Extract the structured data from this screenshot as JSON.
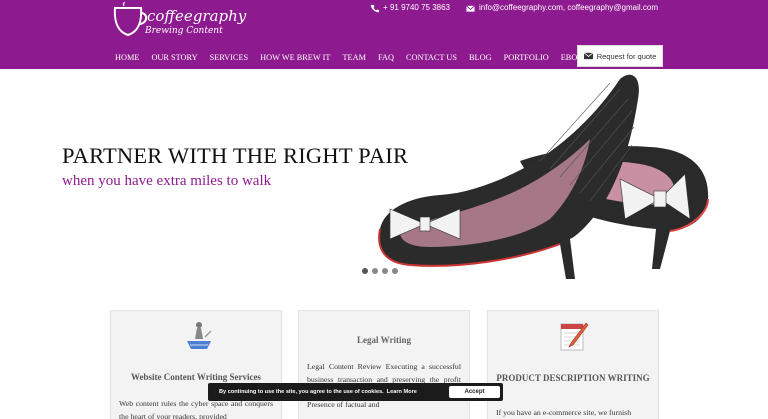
{
  "brand": {
    "name": "coffeegraphy",
    "tagline": "Brewing Content"
  },
  "contact": {
    "phone_icon": "phone-icon",
    "phone": "+ 91 9740 75 3863",
    "mail_icon": "envelope-icon",
    "email": "info@coffeegraphy.com, coffeegraphy@gmail.com"
  },
  "nav": {
    "items": [
      {
        "label": "HOME"
      },
      {
        "label": "OUR STORY"
      },
      {
        "label": "SERVICES"
      },
      {
        "label": "HOW WE BREW IT"
      },
      {
        "label": "TEAM"
      },
      {
        "label": "FAQ"
      },
      {
        "label": "CONTACT US"
      },
      {
        "label": "BLOG"
      },
      {
        "label": "PORTFOLIO"
      },
      {
        "label": "EBOOKS"
      }
    ],
    "quote_label": "Request for quote",
    "quote_icon": "envelope-icon"
  },
  "hero": {
    "title": "PARTNER WITH THE RIGHT PAIR",
    "subtitle": "when you have extra miles to walk",
    "slide_count": 4,
    "active_slide": 1
  },
  "cards": [
    {
      "icon": "writer-at-desk-icon",
      "title": "Website Content Writing Services",
      "body": "Web content rules the cyber space and conquers the heart of your readers, provided"
    },
    {
      "icon": "",
      "title": "Legal Writing",
      "body": "Legal Content Review Executing a successful business transaction and preserving the profit unwanted surprises or unavoidable litigations. Presence of factual and"
    },
    {
      "icon": "notepad-pencil-icon",
      "title": "PRODUCT DESCRIPTION WRITING",
      "body": "If you have an e-commerce site, we furnish"
    }
  ],
  "cookie": {
    "text": "By continuing to use the site, you agree to the use of cookies.",
    "link": "Learn More",
    "accept": "Accept"
  },
  "colors": {
    "brand_purple": "#8e1a8f",
    "hero_subtitle": "#8e1a8f"
  }
}
